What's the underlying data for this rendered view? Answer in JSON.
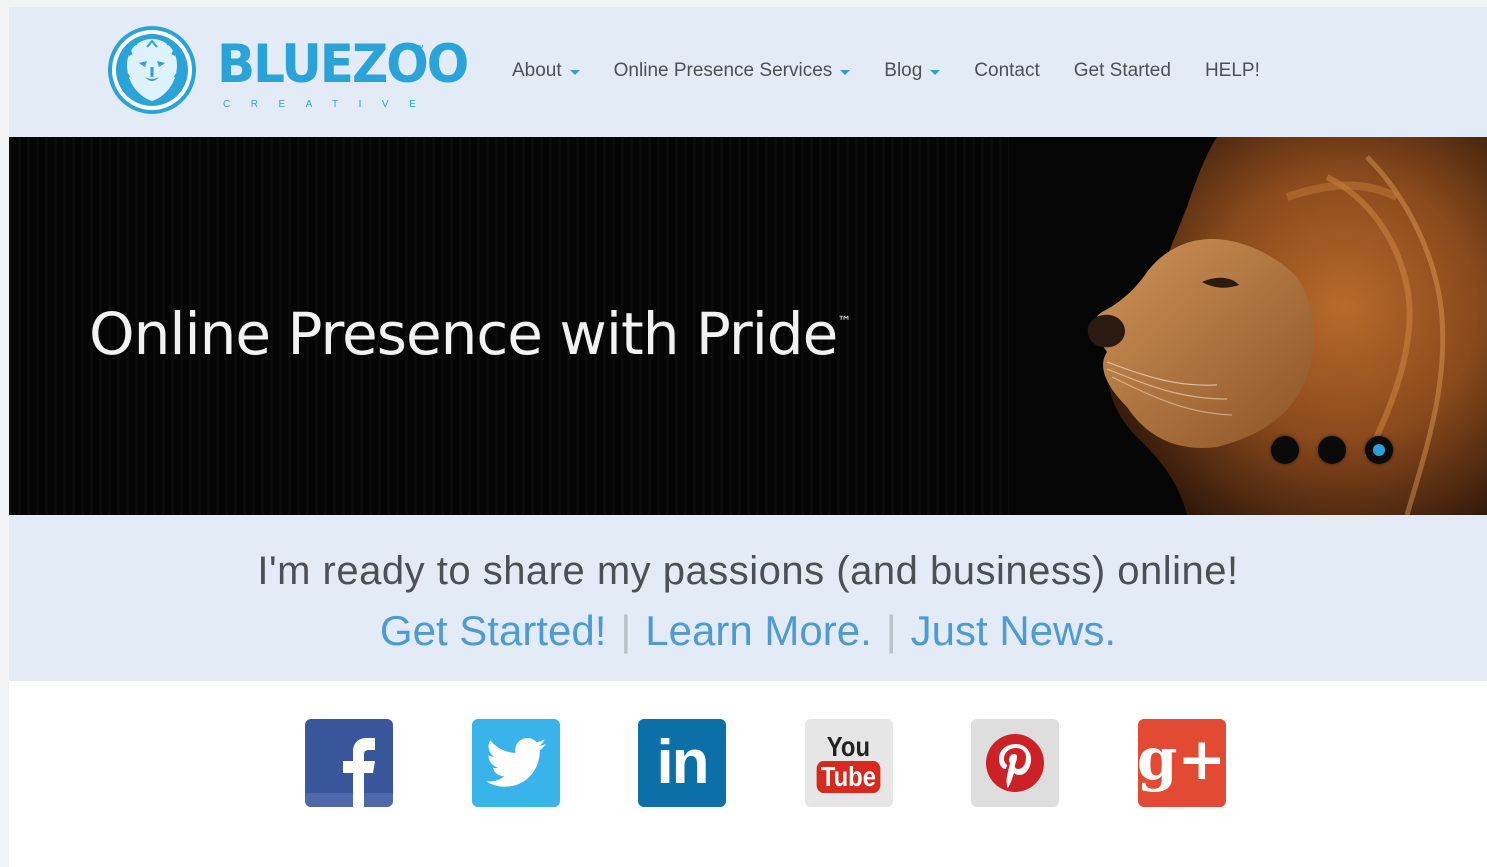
{
  "brand": {
    "wordmark": "BLUEZOO",
    "tagline": "CREATIVE",
    "tm": "™"
  },
  "nav": {
    "items": [
      {
        "label": "About",
        "dropdown": true
      },
      {
        "label": "Online Presence Services",
        "dropdown": true
      },
      {
        "label": "Blog",
        "dropdown": true
      },
      {
        "label": "Contact",
        "dropdown": false
      },
      {
        "label": "Get Started",
        "dropdown": false
      },
      {
        "label": "HELP!",
        "dropdown": false
      }
    ]
  },
  "hero": {
    "title": "Online Presence with Pride",
    "tm": "™",
    "slides": 3,
    "active_slide": 3
  },
  "cta": {
    "headline": "I'm ready to share my passions (and business) online!",
    "links": [
      "Get Started!",
      "Learn More.",
      "Just News."
    ],
    "separator": "|"
  },
  "social": {
    "icons": [
      "facebook-icon",
      "twitter-icon",
      "linkedin-icon",
      "youtube-icon",
      "pinterest-icon",
      "google-plus-icon"
    ],
    "youtube_top": "You",
    "youtube_bottom": "Tube",
    "linkedin_text": "in",
    "googleplus_text": "g+"
  },
  "colors": {
    "accent": "#2d9fd8",
    "header_bg": "#e3ecf6",
    "link": "#4e9bd4",
    "text": "#4b5055"
  }
}
